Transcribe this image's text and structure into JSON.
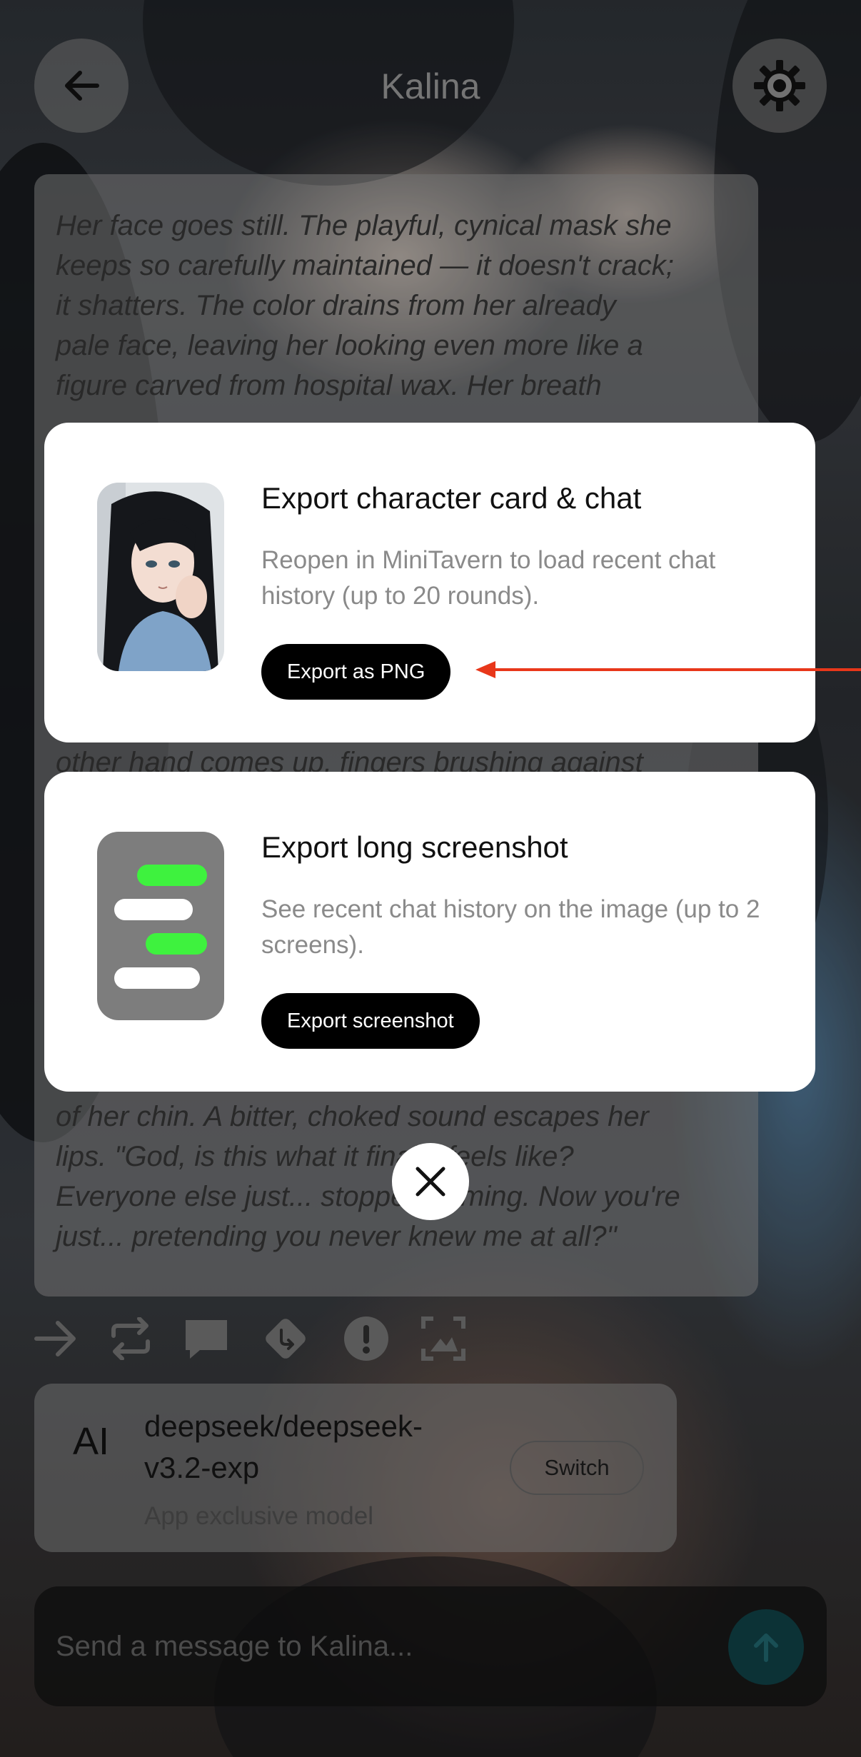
{
  "header": {
    "title": "Kalina",
    "back_icon": "arrow-left-icon",
    "settings_icon": "gear-icon"
  },
  "message": {
    "lines_top": [
      "Her face goes still. The playful, cynical mask she",
      "keeps so carefully maintained — it doesn't crack;",
      "it shatters. The color drains from her already",
      "pale face, leaving her looking even more like a",
      "figure carved from hospital wax. Her breath"
    ],
    "line_mid": "other hand comes up, fingers brushing against",
    "lines_bottom": [
      "of her chin. A bitter, choked sound escapes her",
      "lips. \"God, is this what it finally feels like?",
      "Everyone else just... stopped coming. Now you're",
      "just... pretending you never knew me at all?\""
    ]
  },
  "actions": {
    "icons": [
      "forward-arrow-icon",
      "regenerate-icon",
      "comment-icon",
      "branch-icon",
      "report-icon",
      "image-icon"
    ]
  },
  "model": {
    "badge": "AI",
    "name_line1": "deepseek/deepseek-",
    "name_line2": "v3.2-exp",
    "subtitle": "App exclusive model",
    "switch_label": "Switch"
  },
  "input": {
    "placeholder": "Send a message to Kalina...",
    "send_icon": "arrow-up-icon"
  },
  "export_png": {
    "title": "Export character card & chat",
    "description": "Reopen in MiniTavern to load recent chat history (up to 20 rounds).",
    "button_label": "Export as PNG",
    "thumbnail": "character-portrait"
  },
  "export_screenshot": {
    "title": "Export long screenshot",
    "description": "See recent chat history on the image (up to 2 screens).",
    "button_label": "Export screenshot",
    "thumbnail": "chat-bubbles-icon"
  },
  "colors": {
    "accent_green": "#3ef23e",
    "annotation_arrow": "#e8371a",
    "card_bg": "#ffffff",
    "button_bg": "#000000"
  },
  "close_icon": "close-icon"
}
